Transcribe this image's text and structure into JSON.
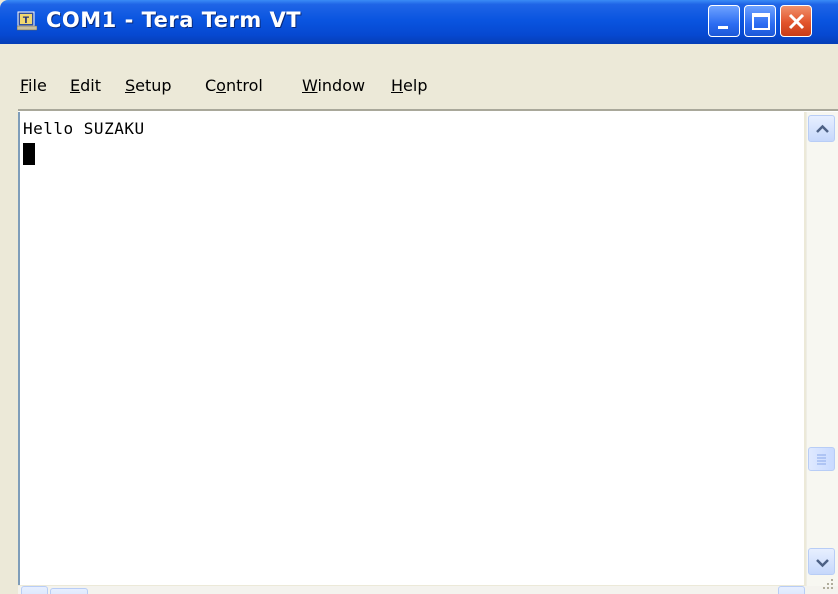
{
  "window": {
    "title": "COM1 - Tera Term VT",
    "icon": "tera-term-icon",
    "buttons": [
      "minimize-icon",
      "maximize-icon",
      "close-icon"
    ]
  },
  "menu": {
    "items": [
      {
        "label": "File",
        "mnemonic": "F"
      },
      {
        "label": "Edit",
        "mnemonic": "E"
      },
      {
        "label": "Setup",
        "mnemonic": "S"
      },
      {
        "label": "Control",
        "mnemonic": "o"
      },
      {
        "label": "Window",
        "mnemonic": "W"
      },
      {
        "label": "Help",
        "mnemonic": "H"
      }
    ]
  },
  "terminal": {
    "lines": [
      "Hello SUZAKU"
    ],
    "cursor": "block"
  },
  "colors": {
    "titlebar": "#0a55e0",
    "close_button": "#e2542c",
    "background": "#ece9d8",
    "terminal_bg": "#ffffff"
  }
}
